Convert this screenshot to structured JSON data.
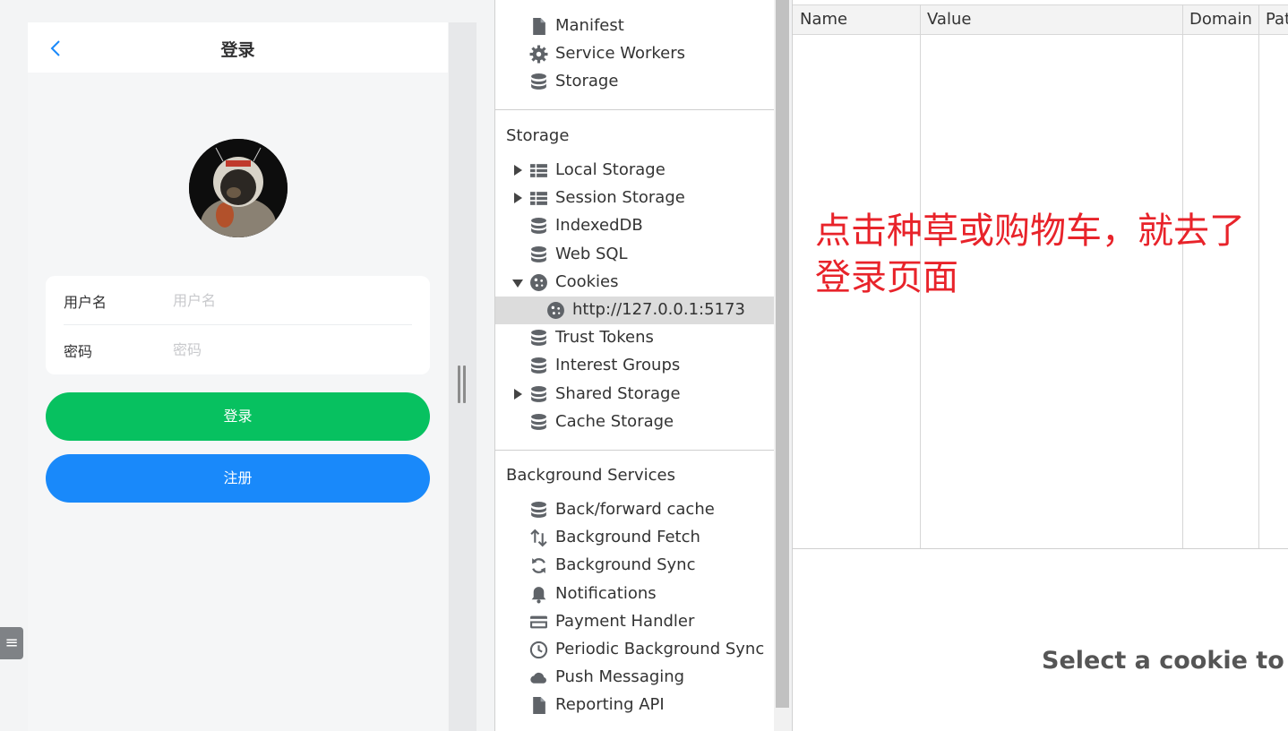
{
  "mobile": {
    "nav_title": "登录",
    "username_label": "用户名",
    "username_placeholder": "用户名",
    "password_label": "密码",
    "password_placeholder": "密码",
    "login_button": "登录",
    "register_button": "注册",
    "side_tab_icon": "≡",
    "colors": {
      "login": "#07c160",
      "register": "#1989fa",
      "back": "#1989fa"
    }
  },
  "sidebar": {
    "app_items": [
      {
        "label": "Manifest",
        "icon": "file-icon"
      },
      {
        "label": "Service Workers",
        "icon": "gear-icon"
      },
      {
        "label": "Storage",
        "icon": "database-icon"
      }
    ],
    "storage_heading": "Storage",
    "storage_items": [
      {
        "label": "Local Storage",
        "icon": "grid-icon",
        "expander": "collapsed"
      },
      {
        "label": "Session Storage",
        "icon": "grid-icon",
        "expander": "collapsed"
      },
      {
        "label": "IndexedDB",
        "icon": "database-icon"
      },
      {
        "label": "Web SQL",
        "icon": "database-icon"
      },
      {
        "label": "Cookies",
        "icon": "cookie-icon",
        "expander": "expanded"
      },
      {
        "label": "http://127.0.0.1:5173",
        "icon": "cookie-icon",
        "selected": true
      },
      {
        "label": "Trust Tokens",
        "icon": "database-icon"
      },
      {
        "label": "Interest Groups",
        "icon": "database-icon"
      },
      {
        "label": "Shared Storage",
        "icon": "database-icon",
        "expander": "collapsed"
      },
      {
        "label": "Cache Storage",
        "icon": "database-icon"
      }
    ],
    "background_heading": "Background Services",
    "background_items": [
      {
        "label": "Back/forward cache",
        "icon": "database-icon"
      },
      {
        "label": "Background Fetch",
        "icon": "up-down-arrows-icon"
      },
      {
        "label": "Background Sync",
        "icon": "sync-icon"
      },
      {
        "label": "Notifications",
        "icon": "bell-icon"
      },
      {
        "label": "Payment Handler",
        "icon": "credit-card-icon"
      },
      {
        "label": "Periodic Background Sync",
        "icon": "clock-icon"
      },
      {
        "label": "Push Messaging",
        "icon": "cloud-icon"
      },
      {
        "label": "Reporting API",
        "icon": "file-icon"
      }
    ]
  },
  "cookie_table": {
    "columns": [
      "Name",
      "Value",
      "Domain",
      "Pat"
    ],
    "annotation": "点击种草或购物车，就去了登录页面",
    "annotation_color": "#e8232a",
    "preview_message": "Select a cookie to pre"
  }
}
